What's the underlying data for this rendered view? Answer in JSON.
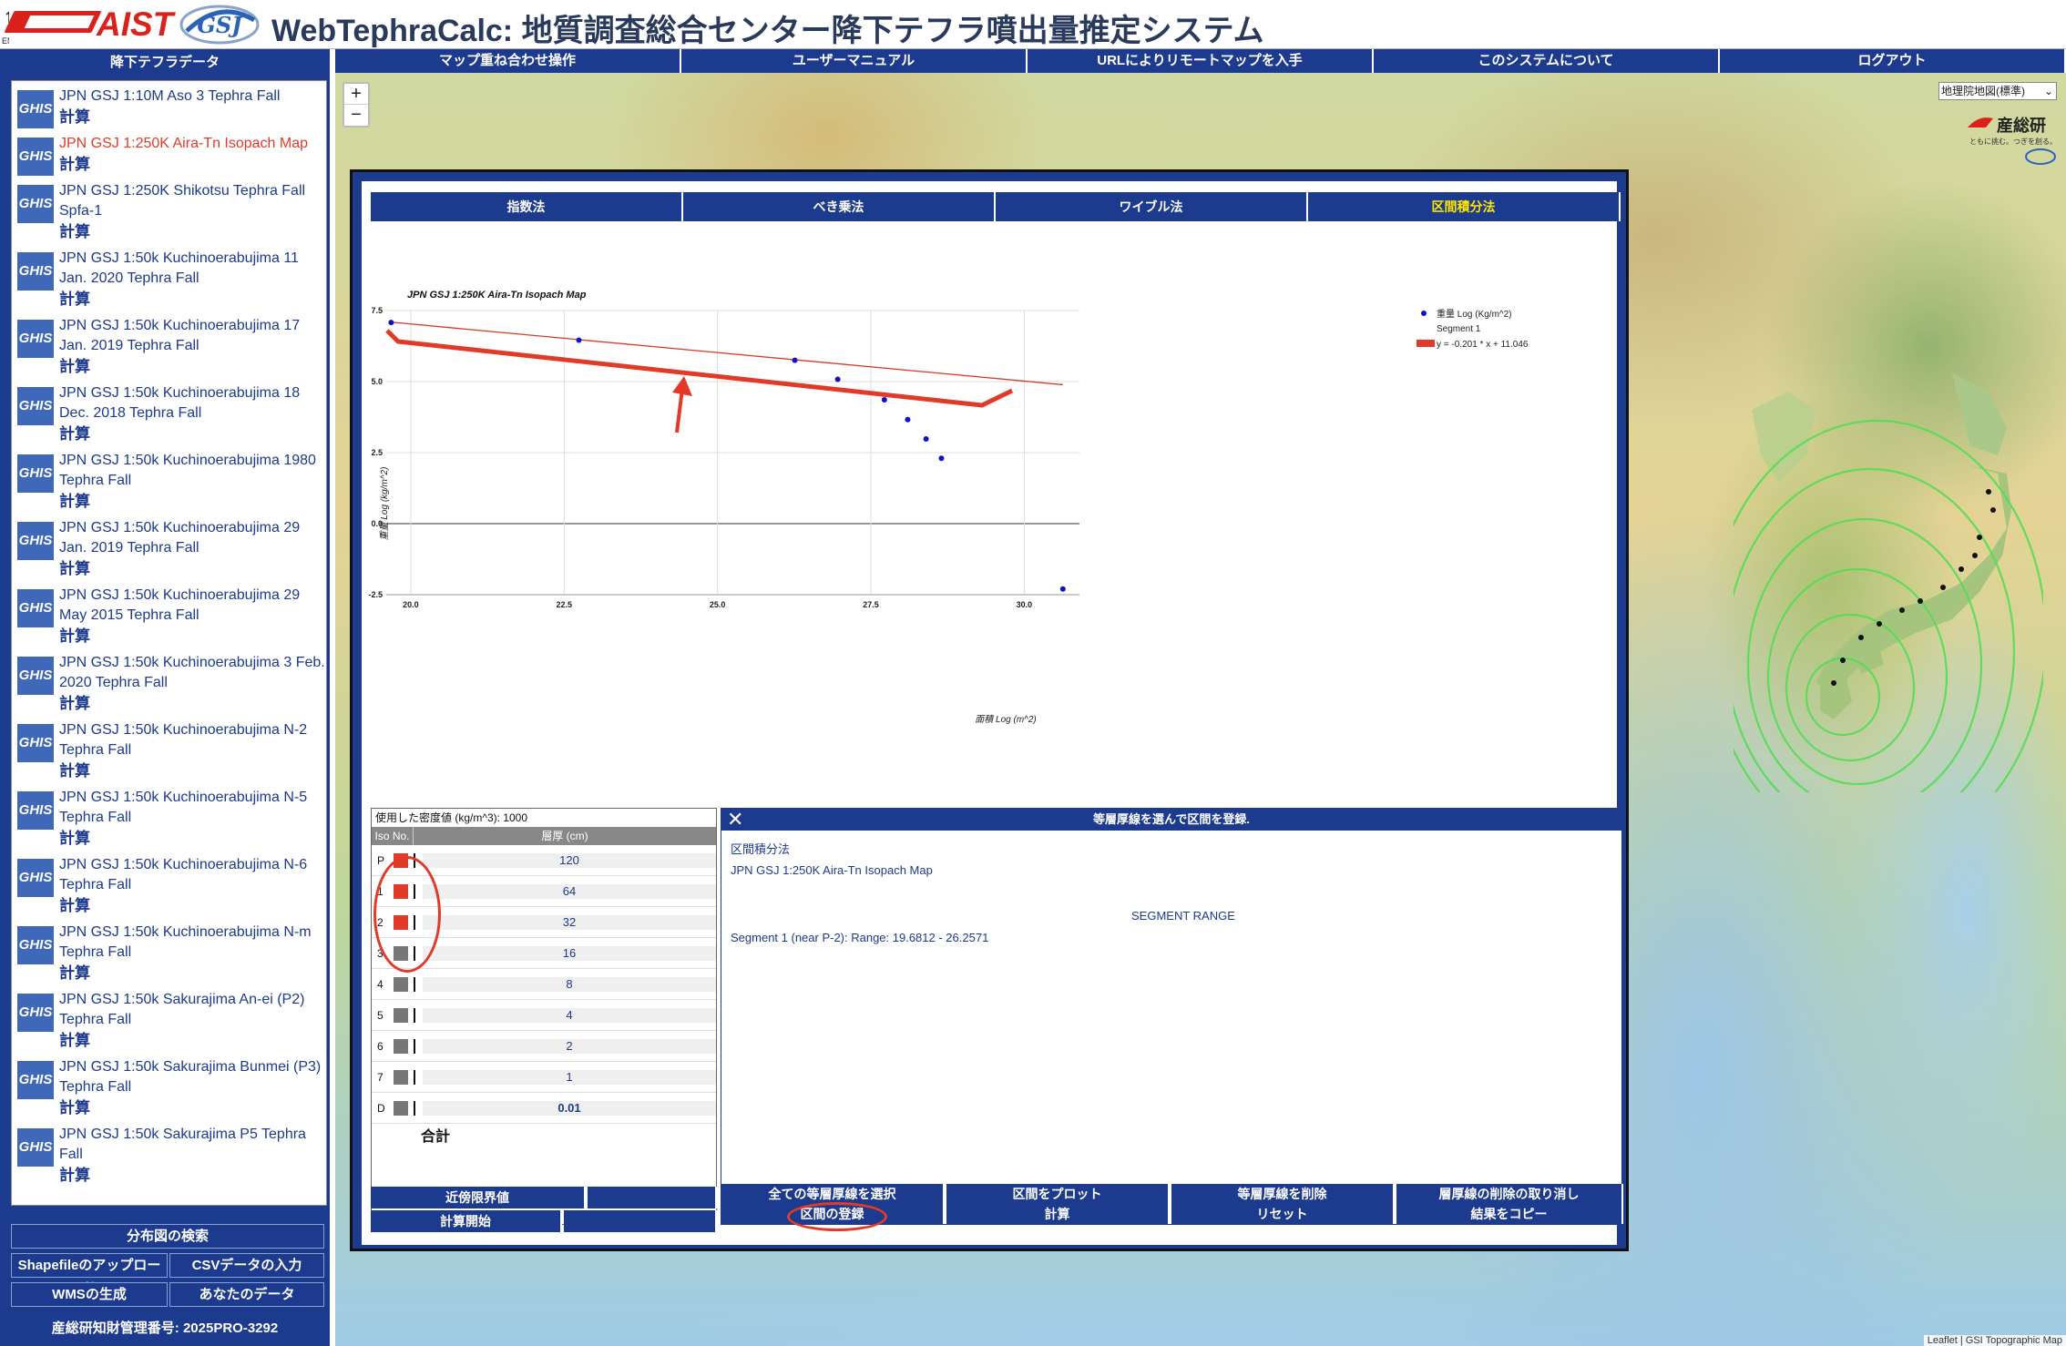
{
  "header": {
    "english_link": "ENGLISH",
    "brand": "AIST",
    "title": "WebTephraCalc: 地質調査総合センター降下テフラ噴出量推定システム"
  },
  "sidebar": {
    "title": "降下テフラデータ",
    "icon_label": "GHIS",
    "calc_label": "計算",
    "datasets": [
      {
        "name": "JPN GSJ 1:10M Aso 3 Tephra Fall",
        "active": false
      },
      {
        "name": "JPN GSJ 1:250K Aira-Tn Isopach Map",
        "active": true
      },
      {
        "name": "JPN GSJ 1:250K Shikotsu Tephra Fall Spfa-1",
        "active": false
      },
      {
        "name": "JPN GSJ 1:50k Kuchinoerabujima 11 Jan. 2020 Tephra Fall",
        "active": false
      },
      {
        "name": "JPN GSJ 1:50k Kuchinoerabujima 17 Jan. 2019 Tephra Fall",
        "active": false
      },
      {
        "name": "JPN GSJ 1:50k Kuchinoerabujima 18 Dec. 2018 Tephra Fall",
        "active": false
      },
      {
        "name": "JPN GSJ 1:50k Kuchinoerabujima 1980 Tephra Fall",
        "active": false
      },
      {
        "name": "JPN GSJ 1:50k Kuchinoerabujima 29 Jan. 2019 Tephra Fall",
        "active": false
      },
      {
        "name": "JPN GSJ 1:50k Kuchinoerabujima 29 May 2015 Tephra Fall",
        "active": false
      },
      {
        "name": "JPN GSJ 1:50k Kuchinoerabujima 3 Feb. 2020 Tephra Fall",
        "active": false
      },
      {
        "name": "JPN GSJ 1:50k Kuchinoerabujima N-2 Tephra Fall",
        "active": false
      },
      {
        "name": "JPN GSJ 1:50k Kuchinoerabujima N-5 Tephra Fall",
        "active": false
      },
      {
        "name": "JPN GSJ 1:50k Kuchinoerabujima N-6 Tephra Fall",
        "active": false
      },
      {
        "name": "JPN GSJ 1:50k Kuchinoerabujima N-m Tephra Fall",
        "active": false
      },
      {
        "name": "JPN GSJ 1:50k Sakurajima An-ei (P2) Tephra Fall",
        "active": false
      },
      {
        "name": "JPN GSJ 1:50k Sakurajima Bunmei (P3) Tephra Fall",
        "active": false
      },
      {
        "name": "JPN GSJ 1:50k Sakurajima P5 Tephra Fall",
        "active": false
      }
    ],
    "search_button": "分布図の検索",
    "shapefile_upload": "Shapefileのアップロード",
    "csv_input": "CSVデータの入力",
    "wms_generate": "WMSの生成",
    "your_data": "あなたのデータ",
    "ip_number": "産総研知財管理番号: 2025PRO-3292"
  },
  "topnav": [
    "マップ重ね合わせ操作",
    "ユーザーマニュアル",
    "URLによりリモートマップを入手",
    "このシステムについて",
    "ログアウト"
  ],
  "map": {
    "basemap_select": "地理院地図(標準)",
    "sankoken_text": "産総研",
    "sankoken_tagline": "ともに挑む。つぎを創る。",
    "attribution": "Leaflet | GSI Topographic Map",
    "zoom_in": "+",
    "zoom_out": "−"
  },
  "methods": {
    "tabs": [
      "指数法",
      "べき乗法",
      "ワイブル法",
      "区間積分法"
    ],
    "active_index": 3
  },
  "chart_data": {
    "type": "scatter",
    "title": "JPN GSJ 1:250K Aira-Tn Isopach Map",
    "xlabel": "面積 Log (m^2)",
    "ylabel": "重量 Log (kg/m^2)",
    "xlim": [
      19.6,
      30.9
    ],
    "ylim": [
      -2.5,
      7.5
    ],
    "xticks": [
      "20.0",
      "22.5",
      "25.0",
      "27.5",
      "30.0"
    ],
    "yticks": [
      "7.5",
      "5.0",
      "2.5",
      "0.0",
      "-2.5"
    ],
    "grid": true,
    "legend_position": "top-right",
    "series": [
      {
        "name": "重量 Log (Kg/m^2)",
        "color": "#1010c8",
        "x": [
          19.68,
          22.74,
          26.26,
          26.96,
          27.72,
          28.1,
          28.4,
          28.65,
          30.63
        ],
        "y": [
          7.08,
          6.46,
          5.75,
          5.08,
          4.36,
          3.66,
          2.98,
          2.3,
          -2.3
        ]
      }
    ],
    "legend_segment": "Segment 1",
    "fit": {
      "label": "y = -0.201 * x + 11.046",
      "slope": -0.201,
      "intercept": 11.046,
      "x_range": [
        19.68,
        30.63
      ],
      "color": "#d43a2a"
    }
  },
  "density": {
    "label": "使用した密度値 (kg/m^3): 1000",
    "col_iso": "Iso No.",
    "col_thickness": "層厚 (cm)",
    "rows": [
      {
        "no": "P",
        "value": "120",
        "color": "#e23a28"
      },
      {
        "no": "1",
        "value": "64",
        "color": "#e23a28"
      },
      {
        "no": "2",
        "value": "32",
        "color": "#e23a28"
      },
      {
        "no": "3",
        "value": "16",
        "color": "#777777"
      },
      {
        "no": "4",
        "value": "8",
        "color": "#777777"
      },
      {
        "no": "5",
        "value": "4",
        "color": "#777777"
      },
      {
        "no": "6",
        "value": "2",
        "color": "#777777"
      },
      {
        "no": "7",
        "value": "1",
        "color": "#777777"
      },
      {
        "no": "D",
        "value": "0.01",
        "color": "#777777"
      }
    ],
    "total_label": "合計",
    "near_limit_button": "近傍限界値",
    "calc_start_button": "計算開始"
  },
  "segment": {
    "header": "等層厚線を選んで区間を登録.",
    "method_label": "区間積分法",
    "map_name": "JPN GSJ 1:250K Aira-Tn Isopach Map",
    "range_title": "SEGMENT RANGE",
    "range_text": "Segment 1 (near P-2): Range: 19.6812  -  26.2571",
    "buttons_row1": [
      "全ての等層厚線を選択",
      "区間をプロット",
      "等層厚線を削除",
      "層厚線の削除の取り消し"
    ],
    "buttons_row2": [
      "区間の登録",
      "計算",
      "リセット",
      "結果をコピー"
    ]
  }
}
